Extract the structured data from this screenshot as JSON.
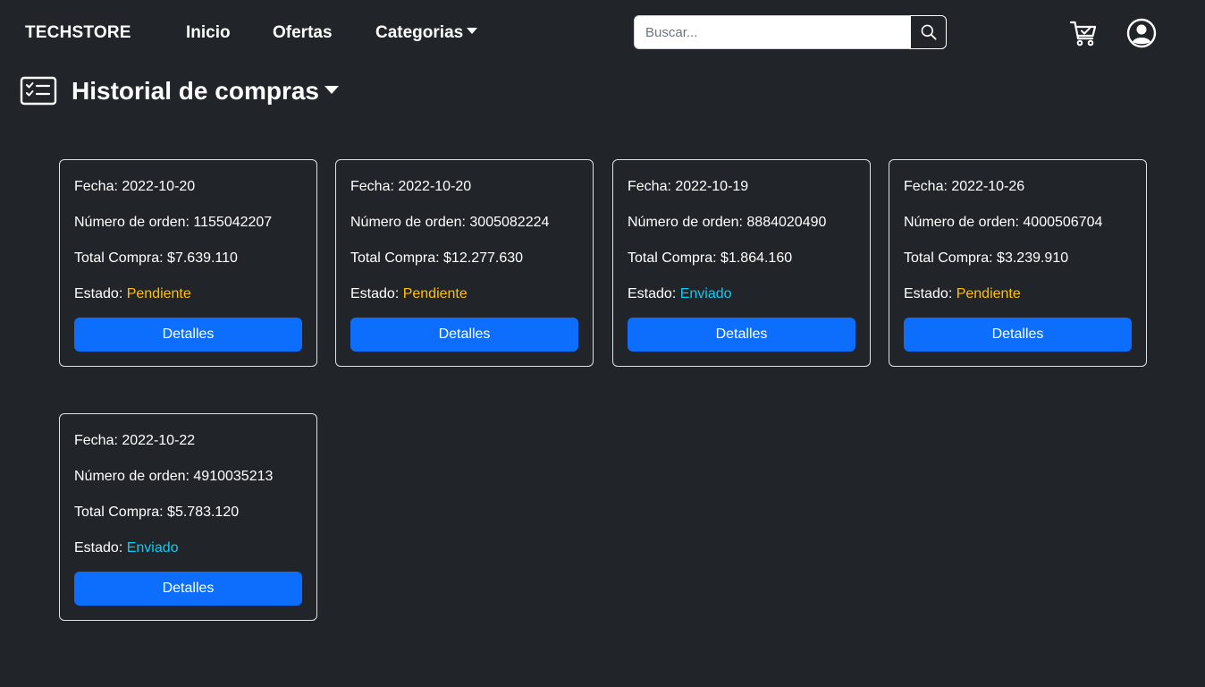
{
  "brand": "TECHSTORE",
  "nav": {
    "home": "Inicio",
    "offers": "Ofertas",
    "categories": "Categorias"
  },
  "search": {
    "placeholder": "Buscar..."
  },
  "history": {
    "title": "Historial de compras"
  },
  "labels": {
    "date": "Fecha: ",
    "order": "Número de orden: ",
    "total": "Total Compra: ",
    "status": "Estado: "
  },
  "orders": [
    {
      "date": "2022-10-20",
      "number": "1155042207",
      "total": "$7.639.110",
      "status": "Pendiente",
      "details": "Detalles"
    },
    {
      "date": "2022-10-20",
      "number": "3005082224",
      "total": "$12.277.630",
      "status": "Pendiente",
      "details": "Detalles"
    },
    {
      "date": "2022-10-19",
      "number": "8884020490",
      "total": "$1.864.160",
      "status": "Enviado",
      "details": "Detalles"
    },
    {
      "date": "2022-10-26",
      "number": "4000506704",
      "total": "$3.239.910",
      "status": "Pendiente",
      "details": "Detalles"
    },
    {
      "date": "2022-10-22",
      "number": "4910035213",
      "total": "$5.783.120",
      "status": "Enviado",
      "details": "Detalles"
    }
  ],
  "colors": {
    "background": "#212529",
    "primary": "#0d6efd",
    "pending": "#ffc107",
    "shipped": "#0dcaf0"
  }
}
